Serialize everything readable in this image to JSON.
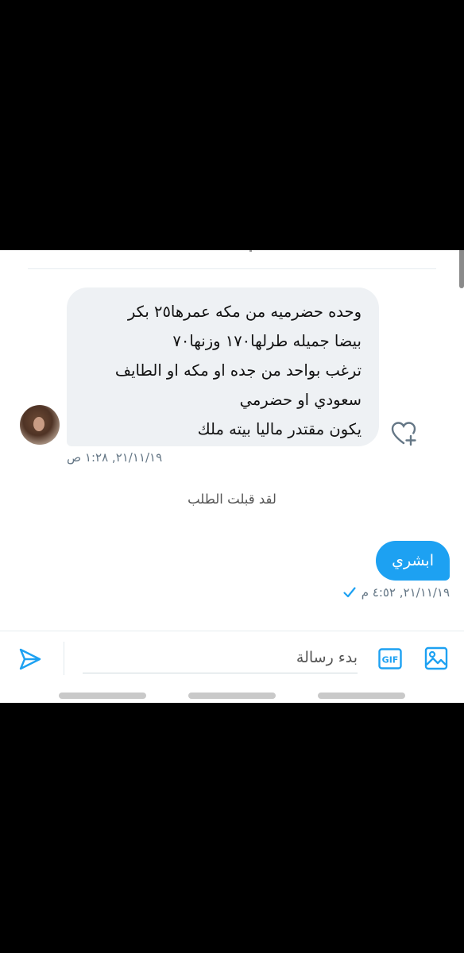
{
  "conversation": {
    "incoming": {
      "lines": [
        "وحده حضرميه  من مكه عمرها٢٥ بكر",
        "بيضا جميله طرلها١٧٠ وزنها٧٠",
        "ترغب بواحد من جده او مكه او الطايف",
        "سعودي او حضرمي",
        "يكون مقتدر ماليا بيته ملك"
      ],
      "timestamp": "٢١/١١/١٩, ١:٢٨ ص",
      "avatar_icon": "user-avatar",
      "react_icon": "heart-plus-icon"
    },
    "system_message": "لقد قبلت الطلب",
    "outgoing": {
      "text": "ابشري",
      "timestamp": "٢١/١١/١٩, ٤:٥٢ م",
      "status_icon": "checkmark-icon"
    }
  },
  "composer": {
    "placeholder": "بدء رسالة",
    "value": "",
    "send_icon": "send-icon",
    "gif_icon": "gif-icon",
    "image_icon": "image-icon"
  },
  "colors": {
    "accent": "#1da1f2",
    "incoming_bubble": "#eef1f4",
    "meta_text": "#657786"
  }
}
